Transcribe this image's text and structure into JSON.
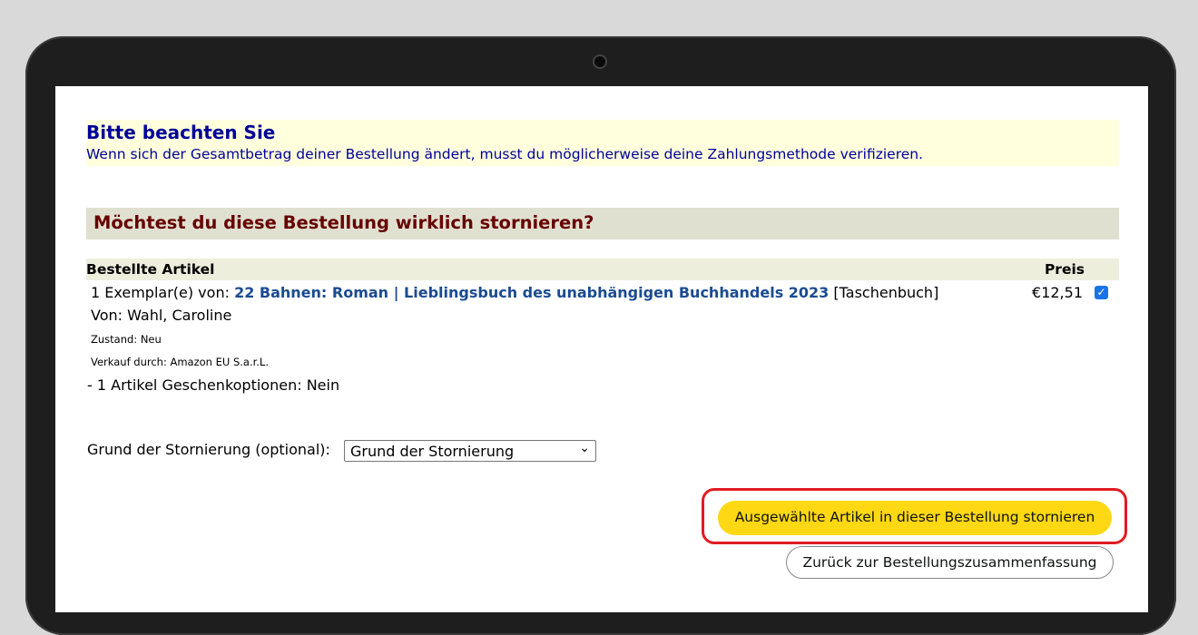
{
  "notice": {
    "title": "Bitte beachten Sie",
    "text": "Wenn sich der Gesamtbetrag deiner Bestellung ändert, musst du möglicherweise deine Zahlungsmethode verifizieren."
  },
  "question": "Möchtest du diese Bestellung wirklich stornieren?",
  "items_table": {
    "header_items": "Bestellte Artikel",
    "header_price": "Preis",
    "item": {
      "quantity_prefix": "1 Exemplar(e) von:",
      "title": "22 Bahnen: Roman | Lieblingsbuch des unabhängigen Buchhandels 2023",
      "format": "[Taschenbuch]",
      "author": "Von: Wahl, Caroline",
      "condition": "Zustand: Neu",
      "seller": "Verkauf durch: Amazon EU S.a.r.L.",
      "gift_options": "- 1 Artikel Geschenkoptionen: Nein",
      "price": "€12,51",
      "checked": true
    }
  },
  "reason": {
    "label": "Grund der Stornierung (optional):",
    "selected": "Grund der Stornierung"
  },
  "buttons": {
    "cancel_selected": "Ausgewählte Artikel in dieser Bestellung stornieren",
    "back": "Zurück zur Bestellungszusammenfassung"
  },
  "colors": {
    "notice_bg": "#ffffdd",
    "notice_text": "#000099",
    "question_text": "#660000",
    "link": "#1a4b91",
    "primary_button": "#ffd814",
    "highlight": "#e11b22"
  }
}
